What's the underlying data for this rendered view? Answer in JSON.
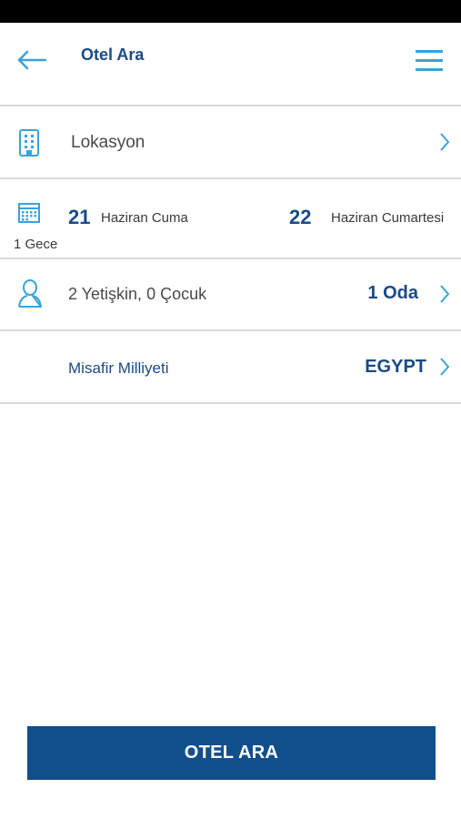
{
  "header": {
    "title": "Otel Ara",
    "back_icon": "arrow-left-icon",
    "menu_icon": "hamburger-menu-icon"
  },
  "location": {
    "label": "Lokasyon",
    "icon": "hotel-building-icon"
  },
  "dates": {
    "icon": "calendar-icon",
    "checkin_day": "21",
    "checkin_text": "Haziran Cuma",
    "checkout_day": "22",
    "checkout_text": "Haziran Cumartesi",
    "nights": "1 Gece"
  },
  "guests": {
    "icon": "person-icon",
    "label": "2 Yetişkin, 0 Çocuk",
    "rooms": "1 Oda"
  },
  "nationality": {
    "label": "Misafir Milliyeti",
    "value": "EGYPT"
  },
  "search_button": {
    "label": "OTEL ARA"
  },
  "colors": {
    "brand": "#114f8c",
    "accent": "#3aa3d9",
    "text_blue": "#1a4a86",
    "divider": "#d9d9d9"
  }
}
